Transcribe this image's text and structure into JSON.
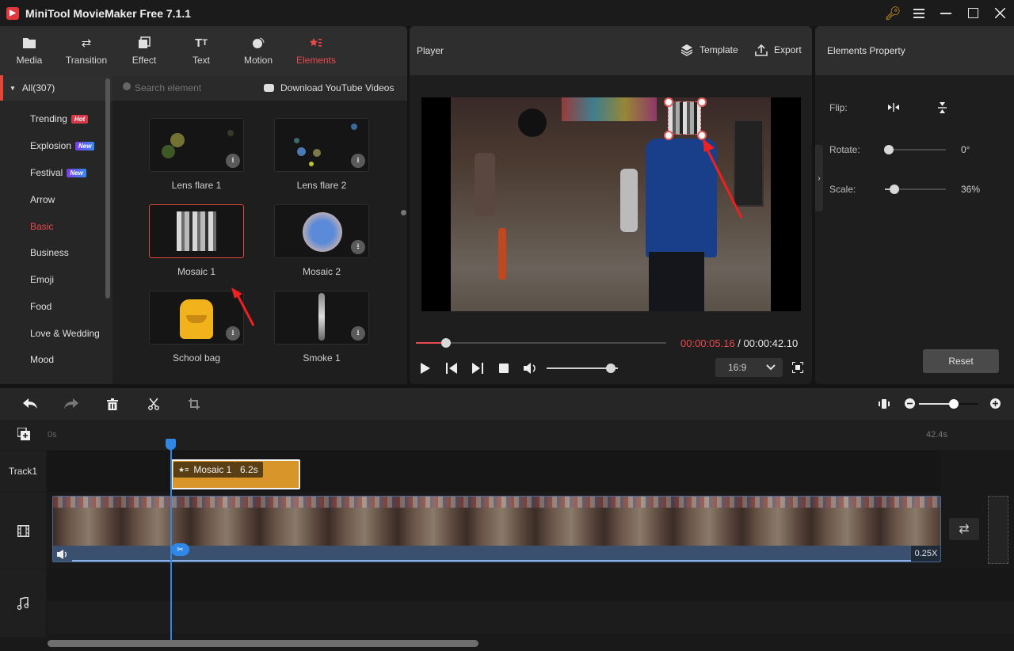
{
  "window": {
    "title": "MiniTool MovieMaker Free 7.1.1",
    "controls": [
      "key-icon",
      "menu-icon",
      "minimize-icon",
      "maximize-icon",
      "close-icon"
    ]
  },
  "tabs": [
    {
      "label": "Media",
      "icon": "folder-icon",
      "active": false
    },
    {
      "label": "Transition",
      "icon": "swap-icon",
      "active": false
    },
    {
      "label": "Effect",
      "icon": "layers-icon",
      "active": false
    },
    {
      "label": "Text",
      "icon": "text-icon",
      "active": false
    },
    {
      "label": "Motion",
      "icon": "motion-icon",
      "active": false
    },
    {
      "label": "Elements",
      "icon": "elements-icon",
      "active": true
    }
  ],
  "categories": {
    "all_label": "All(307)",
    "items": [
      {
        "label": "Trending",
        "badge": "Hot"
      },
      {
        "label": "Explosion",
        "badge": "New"
      },
      {
        "label": "Festival",
        "badge": "New"
      },
      {
        "label": "Arrow",
        "badge": null
      },
      {
        "label": "Basic",
        "badge": null,
        "active": true
      },
      {
        "label": "Business",
        "badge": null
      },
      {
        "label": "Emoji",
        "badge": null
      },
      {
        "label": "Food",
        "badge": null
      },
      {
        "label": "Love & Wedding",
        "badge": null
      },
      {
        "label": "Mood",
        "badge": null
      }
    ]
  },
  "search": {
    "placeholder": "Search element",
    "download_label": "Download YouTube Videos"
  },
  "elements": [
    {
      "label": "Lens flare 1",
      "downloadable": true,
      "selected": false
    },
    {
      "label": "Lens flare 2",
      "downloadable": true,
      "selected": false
    },
    {
      "label": "Mosaic 1",
      "downloadable": false,
      "selected": true
    },
    {
      "label": "Mosaic 2",
      "downloadable": true,
      "selected": false
    },
    {
      "label": "School bag",
      "downloadable": true,
      "selected": false
    },
    {
      "label": "Smoke 1",
      "downloadable": true,
      "selected": false
    }
  ],
  "player": {
    "title": "Player",
    "template_label": "Template",
    "export_label": "Export",
    "current_time": "00:00:05.16",
    "separator": " / ",
    "total_time": "00:00:42.10",
    "progress_fraction": 0.12,
    "volume_fraction": 0.9,
    "aspect_ratio": "16:9"
  },
  "properties": {
    "title": "Elements Property",
    "flip_label": "Flip:",
    "rotate_label": "Rotate:",
    "rotate_value": "0°",
    "rotate_fraction": 0.0,
    "scale_label": "Scale:",
    "scale_value": "36%",
    "scale_fraction": 0.1,
    "reset_label": "Reset"
  },
  "timeline": {
    "start_label": "0s",
    "end_label": "42.4s",
    "zoom_fraction": 0.58,
    "track1_label": "Track1",
    "clip": {
      "name": "Mosaic 1",
      "duration": "6.2s"
    },
    "video_speed": "0.25X"
  },
  "colors": {
    "accent": "#e9494d",
    "playhead": "#2f87e8",
    "clip": "#d8952a"
  }
}
